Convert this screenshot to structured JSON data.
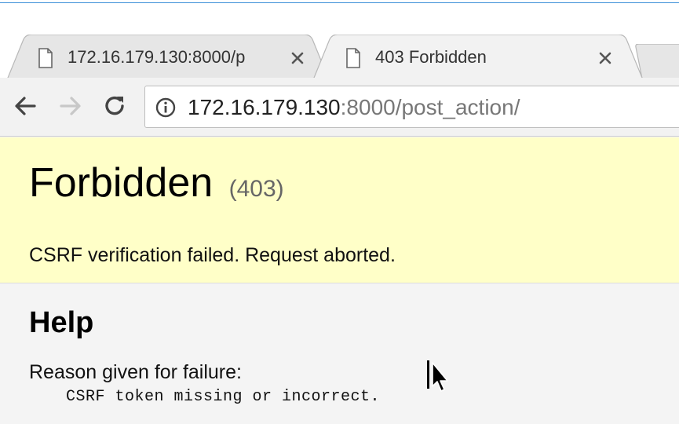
{
  "browser": {
    "tabs": [
      {
        "title": "172.16.179.130:8000/p",
        "active": false,
        "icon": "page-icon"
      },
      {
        "title": "403 Forbidden",
        "active": true,
        "icon": "page-icon"
      }
    ],
    "toolbar": {
      "back_icon": "arrow-left-icon",
      "forward_icon": "arrow-right-icon",
      "reload_icon": "reload-icon",
      "info_icon": "info-icon"
    },
    "address": {
      "host": "172.16.179.130",
      "rest": ":8000/post_action/"
    }
  },
  "page": {
    "title": "Forbidden",
    "status_code": "(403)",
    "message": "CSRF verification failed. Request aborted.",
    "help": {
      "heading": "Help",
      "reason_label": "Reason given for failure:",
      "reason": "CSRF token missing or incorrect."
    }
  },
  "colors": {
    "summary_bg": "#ffffc8",
    "page_bg": "#f4f4f4",
    "toolbar_bg": "#f2f2f2",
    "window_border": "#3c8fd8"
  }
}
